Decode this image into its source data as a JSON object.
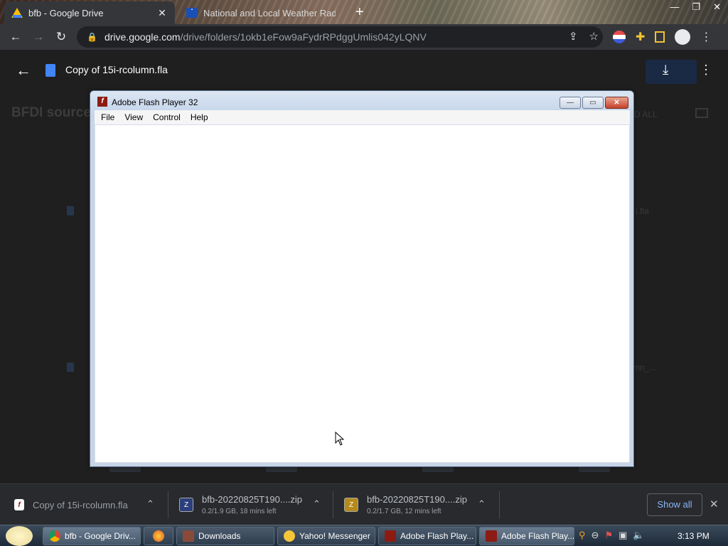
{
  "browser": {
    "tabs": [
      {
        "title": "bfb - Google Drive",
        "favicon": "google-drive-icon",
        "close_glyph": "✕",
        "active": true
      },
      {
        "title": "National and Local Weather Rad",
        "favicon": "weather-channel-icon",
        "active": false
      }
    ],
    "new_tab_glyph": "+",
    "window_controls": [
      "—",
      "❐",
      "✕"
    ],
    "url_host": "drive.google.com",
    "url_path": "/drive/folders/1okb1eFow9aFydrRPdggUmlis042yLQNV"
  },
  "drive": {
    "file_title": "Copy of 15i-rcolumn.fla",
    "folder_name": "BFDI source",
    "right_fragments": [
      "D ALL",
      "i.fla",
      "mn_..."
    ]
  },
  "flash": {
    "title": "Adobe Flash Player 32",
    "menu": [
      "File",
      "View",
      "Control",
      "Help"
    ],
    "minimize_glyph": "—",
    "maximize_glyph": "▭",
    "close_glyph": "✕"
  },
  "downloads": {
    "items": [
      {
        "name": "Copy of 15i-rcolumn.fla",
        "status": "",
        "icon": "flash-file-icon"
      },
      {
        "name": "bfb-20220825T190....zip",
        "status": "0.2/1.9 GB, 18 mins left",
        "icon": "zip-file-icon"
      },
      {
        "name": "bfb-20220825T190....zip",
        "status": "0.2/1.7 GB, 12 mins left",
        "icon": "zip-file-icon"
      }
    ],
    "show_all": "Show all",
    "close_glyph": "✕"
  },
  "taskbar": {
    "buttons": [
      {
        "label": "bfb - Google Driv...",
        "icon": "chrome-icon"
      },
      {
        "label": "",
        "icon": "firefox-icon"
      },
      {
        "label": "Downloads",
        "icon": "folder-icon"
      },
      {
        "label": "Yahoo! Messenger",
        "icon": "yahoo-messenger-icon"
      },
      {
        "label": "Adobe Flash Play...",
        "icon": "flash-icon"
      },
      {
        "label": "Adobe Flash Play...",
        "icon": "flash-icon"
      }
    ],
    "clock": "3:13 PM"
  },
  "colors": {
    "accent_link": "#8ab4f8",
    "flash_red": "#8c1b13",
    "close_red": "#c6402a"
  }
}
